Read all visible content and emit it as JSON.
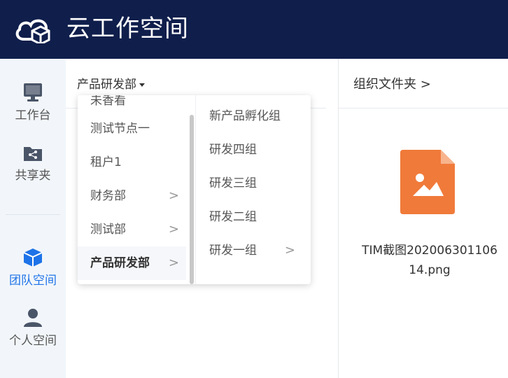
{
  "app": {
    "title": "云工作空间",
    "header_color": "#0f1e4b",
    "accent": "#1e73e8"
  },
  "sidebar": {
    "items": [
      {
        "label": "工作台",
        "icon": "monitor-icon"
      },
      {
        "label": "共享夹",
        "icon": "shared-folder-icon"
      },
      {
        "label": "团队空间",
        "icon": "cube-icon",
        "active": true
      },
      {
        "label": "个人空间",
        "icon": "user-icon"
      }
    ]
  },
  "left": {
    "dept_select": "产品研发部"
  },
  "dropdown": {
    "column1": [
      {
        "label": "未香看"
      },
      {
        "label": "测试节点一"
      },
      {
        "label": "租户1"
      },
      {
        "label": "财务部",
        "has_children": true
      },
      {
        "label": "测试部",
        "has_children": true
      },
      {
        "label": "产品研发部",
        "has_children": true,
        "selected": true
      }
    ],
    "column2": [
      {
        "label": "新产品孵化组"
      },
      {
        "label": "研发四组"
      },
      {
        "label": "研发三组"
      },
      {
        "label": "研发二组"
      },
      {
        "label": "研发一组",
        "has_children": true
      }
    ],
    "chevron": ">"
  },
  "right": {
    "breadcrumb": "组织文件夹 >",
    "file": {
      "name_line1": "TIM截图202006301106",
      "name_line2": "14.png",
      "icon": "image-file-icon",
      "icon_color": "#f07a3a"
    }
  }
}
